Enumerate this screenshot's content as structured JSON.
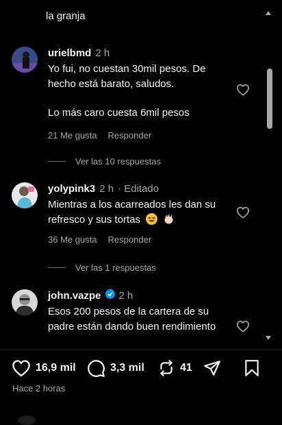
{
  "thread": {
    "top_text": "la granja",
    "comments": [
      {
        "username": "urielbmd",
        "time": "2 h",
        "edited": "",
        "verified": false,
        "lines": [
          "Yo fui, no cuestan 30mil pesos. De hecho está barato, saludos.",
          "",
          "Lo más caro cuesta 6mil pesos"
        ],
        "likes": "21 Me gusta",
        "reply_label": "Responder",
        "view_replies": "Ver las 10 respuestas"
      },
      {
        "username": "yolypink3",
        "time": "2 h",
        "edited": "· Editado",
        "verified": false,
        "lines": [
          "Mientras a los acarreados les dan su refresco y sus tortas"
        ],
        "likes": "36 Me gusta",
        "reply_label": "Responder",
        "view_replies": "Ver las 1 respuestas"
      },
      {
        "username": "john.vazpe",
        "time": "2 h",
        "edited": "",
        "verified": true,
        "lines": [
          "Esos 200 pesos de la cartera de su padre están dando buen rendimiento"
        ]
      }
    ]
  },
  "post_actions": {
    "likes_count": "16,9 mil",
    "comments_count": "3,3 mil",
    "reposts_count": "41",
    "timestamp": "Hace 2 horas"
  },
  "icons": [
    "heart-icon",
    "comment-bubble-icon",
    "repost-icon",
    "share-icon",
    "bookmark-icon",
    "verified-icon",
    "laughing-emoji-icon",
    "clapping-emoji-icon"
  ],
  "colors": {
    "background": "#000000",
    "text": "#f5f5f5",
    "secondary": "#a8a8a8",
    "verified": "#0095f6"
  }
}
